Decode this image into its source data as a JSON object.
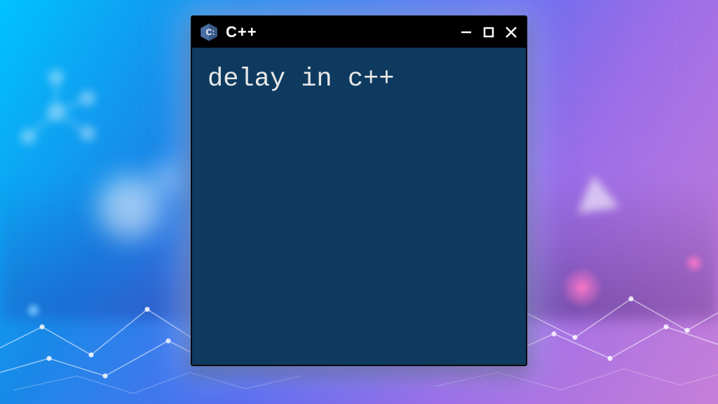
{
  "window": {
    "app_title": "C++",
    "icon_name": "cpp-logo-icon"
  },
  "content": {
    "code_text": "delay in c++"
  },
  "colors": {
    "titlebar": "#000000",
    "window_bg": "#0e3a5f",
    "text": "#e8e8e8"
  }
}
